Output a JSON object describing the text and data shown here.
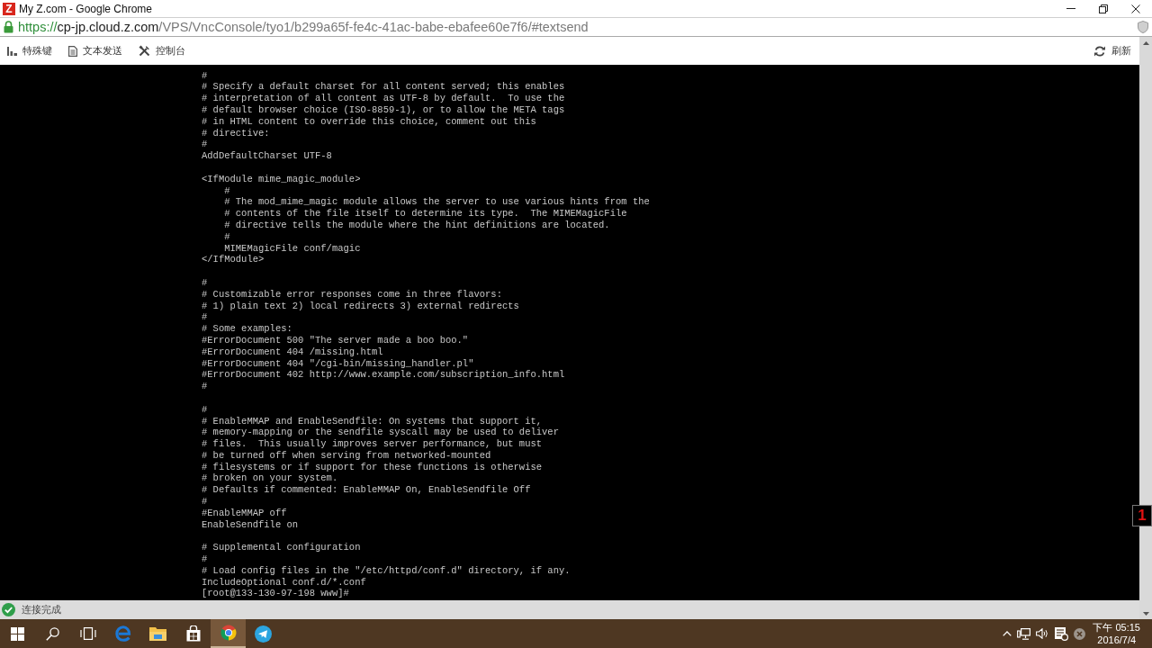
{
  "window": {
    "logo": "Z",
    "title": "My Z.com - Google Chrome"
  },
  "address_bar": {
    "scheme": "https://",
    "host": "cp-jp.cloud.z.com",
    "path": "/VPS/VncConsole/tyo1/b299a65f-fe4c-41ac-babe-ebafee60e7f6/#textsend"
  },
  "toolbar": {
    "items": [
      {
        "kind": "keys",
        "label": "特殊键"
      },
      {
        "kind": "document",
        "label": "文本发送"
      },
      {
        "kind": "tools",
        "label": "控制台"
      }
    ],
    "refresh": {
      "label": "刷新"
    }
  },
  "terminal": {
    "blocks": [
      [
        "#",
        "# Specify a default charset for all content served; this enables",
        "# interpretation of all content as UTF-8 by default.  To use the",
        "# default browser choice (ISO-8859-1), or to allow the META tags",
        "# in HTML content to override this choice, comment out this",
        "# directive:",
        "#",
        "AddDefaultCharset UTF-8"
      ],
      [
        "<IfModule mime_magic_module>",
        "    #",
        "    # The mod_mime_magic module allows the server to use various hints from the",
        "    # contents of the file itself to determine its type.  The MIMEMagicFile",
        "    # directive tells the module where the hint definitions are located.",
        "    #",
        "    MIMEMagicFile conf/magic",
        "</IfModule>"
      ],
      [
        "#",
        "# Customizable error responses come in three flavors:",
        "# 1) plain text 2) local redirects 3) external redirects",
        "#",
        "# Some examples:",
        "#ErrorDocument 500 \"The server made a boo boo.\"",
        "#ErrorDocument 404 /missing.html",
        "#ErrorDocument 404 \"/cgi-bin/missing_handler.pl\"",
        "#ErrorDocument 402 http://www.example.com/subscription_info.html",
        "#"
      ],
      [
        "#",
        "# EnableMMAP and EnableSendfile: On systems that support it,",
        "# memory-mapping or the sendfile syscall may be used to deliver",
        "# files.  This usually improves server performance, but must",
        "# be turned off when serving from networked-mounted",
        "# filesystems or if support for these functions is otherwise",
        "# broken on your system.",
        "# Defaults if commented: EnableMMAP On, EnableSendfile Off",
        "#",
        "#EnableMMAP off",
        "EnableSendfile on"
      ],
      [
        "# Supplemental configuration",
        "#",
        "# Load config files in the \"/etc/httpd/conf.d\" directory, if any.",
        "IncludeOptional conf.d/*.conf",
        "[root@133-130-97-198 www]#"
      ]
    ]
  },
  "badge": {
    "text": "1"
  },
  "status_bar": {
    "text": "连接完成"
  },
  "taskbar": {
    "buttons": [
      {
        "kind": "start",
        "selected": false
      },
      {
        "kind": "search",
        "selected": false
      },
      {
        "kind": "taskview",
        "selected": false
      },
      {
        "kind": "edge",
        "selected": false
      },
      {
        "kind": "files",
        "selected": false
      },
      {
        "kind": "store",
        "selected": false
      },
      {
        "kind": "chrome",
        "selected": true
      },
      {
        "kind": "telegram",
        "selected": false
      }
    ],
    "tray": [
      {
        "kind": "chevron"
      },
      {
        "kind": "network"
      },
      {
        "kind": "volume"
      },
      {
        "kind": "notes"
      },
      {
        "kind": "blocked"
      }
    ],
    "clock": {
      "time": "下午 05:15",
      "date": "2016/7/4"
    }
  }
}
